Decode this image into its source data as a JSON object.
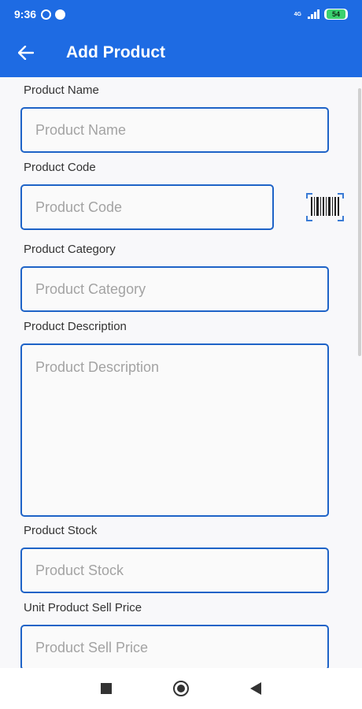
{
  "status_bar": {
    "time": "9:36",
    "network": "4G",
    "battery": "54"
  },
  "toolbar": {
    "title": "Add Product"
  },
  "form": {
    "product_name": {
      "label": "Product Name",
      "placeholder": "Product Name"
    },
    "product_code": {
      "label": "Product Code",
      "placeholder": "Product Code"
    },
    "product_category": {
      "label": "Product Category",
      "placeholder": "Product Category"
    },
    "product_description": {
      "label": "Product Description",
      "placeholder": "Product Description"
    },
    "product_stock": {
      "label": "Product Stock",
      "placeholder": "Product Stock"
    },
    "sell_price": {
      "label": "Unit Product Sell Price",
      "placeholder": "Product Sell Price"
    }
  },
  "icons": {
    "back": "arrow-left",
    "barcode": "barcode-scanner"
  },
  "colors": {
    "primary": "#1e6be3",
    "field_border": "#1e63c7",
    "battery": "#3bd16f"
  }
}
